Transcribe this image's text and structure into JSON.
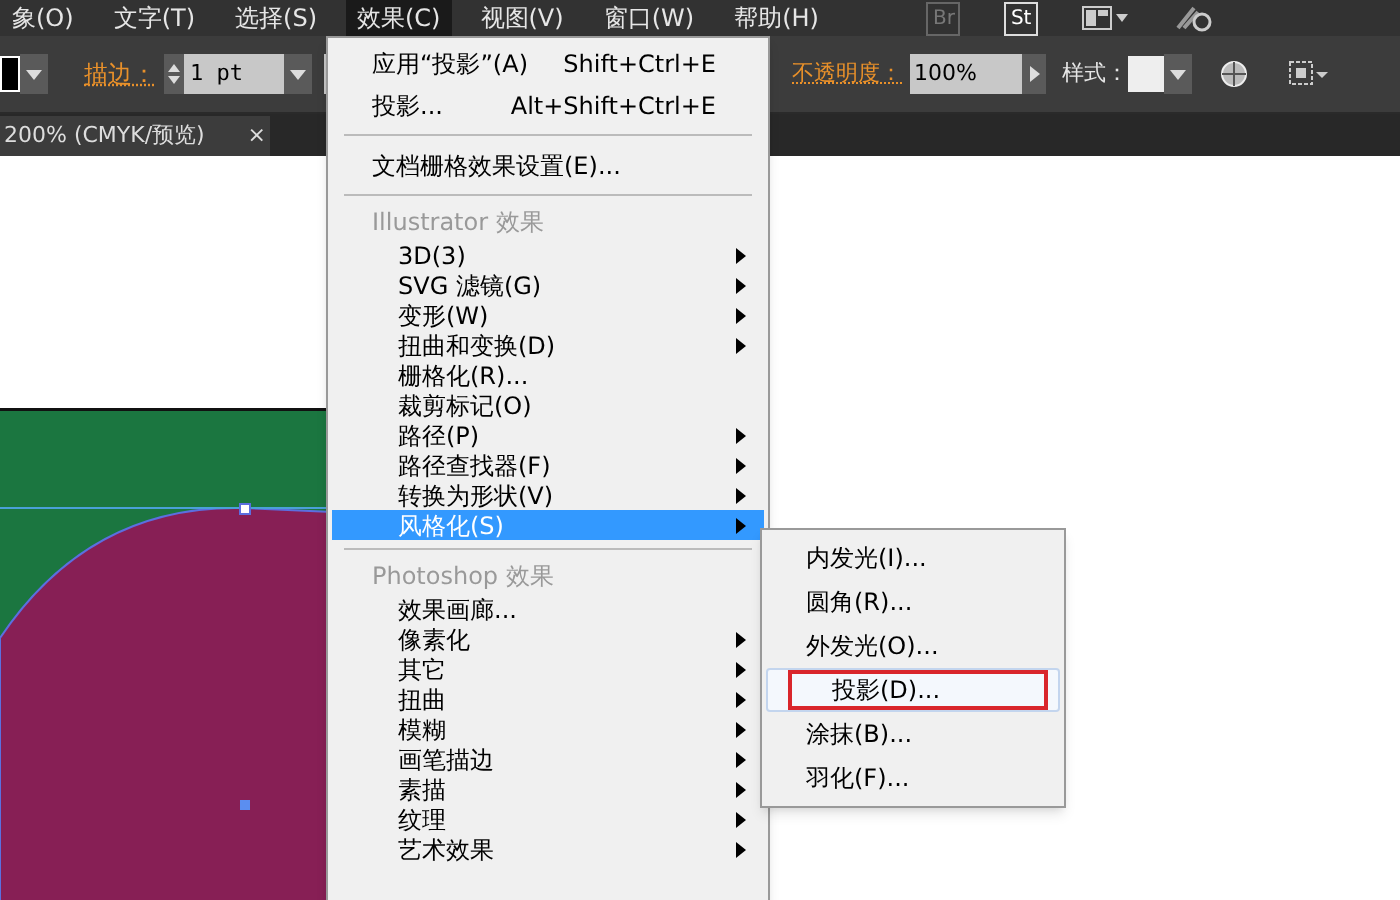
{
  "menu_bar": {
    "items": [
      {
        "label": "象(O)",
        "selected": false
      },
      {
        "label": "文字(T)",
        "selected": false
      },
      {
        "label": "选择(S)",
        "selected": false
      },
      {
        "label": "效果(C)",
        "selected": true
      },
      {
        "label": "视图(V)",
        "selected": false
      },
      {
        "label": "窗口(W)",
        "selected": false
      },
      {
        "label": "帮助(H)",
        "selected": false
      }
    ],
    "app_buttons": [
      "Br",
      "St"
    ]
  },
  "control_bar": {
    "stroke_label": "描边：",
    "stroke_weight": "1 pt",
    "opacity_label": "不透明度：",
    "opacity": "100%",
    "style_label": "样式："
  },
  "document_tab": {
    "title": "200% (CMYK/预览)",
    "close": "×"
  },
  "effect_menu": {
    "top_items": [
      {
        "label": "应用“投影”(A)",
        "shortcut": "Shift+Ctrl+E"
      },
      {
        "label": "投影...",
        "shortcut": "Alt+Shift+Ctrl+E"
      }
    ],
    "document_settings": "文档栅格效果设置(E)...",
    "sections": [
      {
        "header": "Illustrator 效果",
        "items": [
          {
            "label": "3D(3)",
            "submenu": true,
            "selected": false
          },
          {
            "label": "SVG 滤镜(G)",
            "submenu": true,
            "selected": false
          },
          {
            "label": "变形(W)",
            "submenu": true,
            "selected": false
          },
          {
            "label": "扭曲和变换(D)",
            "submenu": true,
            "selected": false
          },
          {
            "label": "栅格化(R)...",
            "submenu": false,
            "selected": false
          },
          {
            "label": "裁剪标记(O)",
            "submenu": false,
            "selected": false
          },
          {
            "label": "路径(P)",
            "submenu": true,
            "selected": false
          },
          {
            "label": "路径查找器(F)",
            "submenu": true,
            "selected": false
          },
          {
            "label": "转换为形状(V)",
            "submenu": true,
            "selected": false
          },
          {
            "label": "风格化(S)",
            "submenu": true,
            "selected": true
          }
        ]
      },
      {
        "header": "Photoshop 效果",
        "items": [
          {
            "label": "效果画廊...",
            "submenu": false,
            "selected": false
          },
          {
            "label": "像素化",
            "submenu": true,
            "selected": false
          },
          {
            "label": "其它",
            "submenu": true,
            "selected": false
          },
          {
            "label": "扭曲",
            "submenu": true,
            "selected": false
          },
          {
            "label": "模糊",
            "submenu": true,
            "selected": false
          },
          {
            "label": "画笔描边",
            "submenu": true,
            "selected": false
          },
          {
            "label": "素描",
            "submenu": true,
            "selected": false
          },
          {
            "label": "纹理",
            "submenu": true,
            "selected": false
          },
          {
            "label": "艺术效果",
            "submenu": true,
            "selected": false
          }
        ]
      }
    ]
  },
  "stylize_submenu": {
    "items": [
      {
        "label": "内发光(I)...",
        "selected": false,
        "highlighted": false
      },
      {
        "label": "圆角(R)...",
        "selected": false,
        "highlighted": false
      },
      {
        "label": "外发光(O)...",
        "selected": false,
        "highlighted": false
      },
      {
        "label": "投影(D)...",
        "selected": true,
        "highlighted": true
      },
      {
        "label": "涂抹(B)...",
        "selected": false,
        "highlighted": false
      },
      {
        "label": "羽化(F)...",
        "selected": false,
        "highlighted": false
      }
    ]
  }
}
